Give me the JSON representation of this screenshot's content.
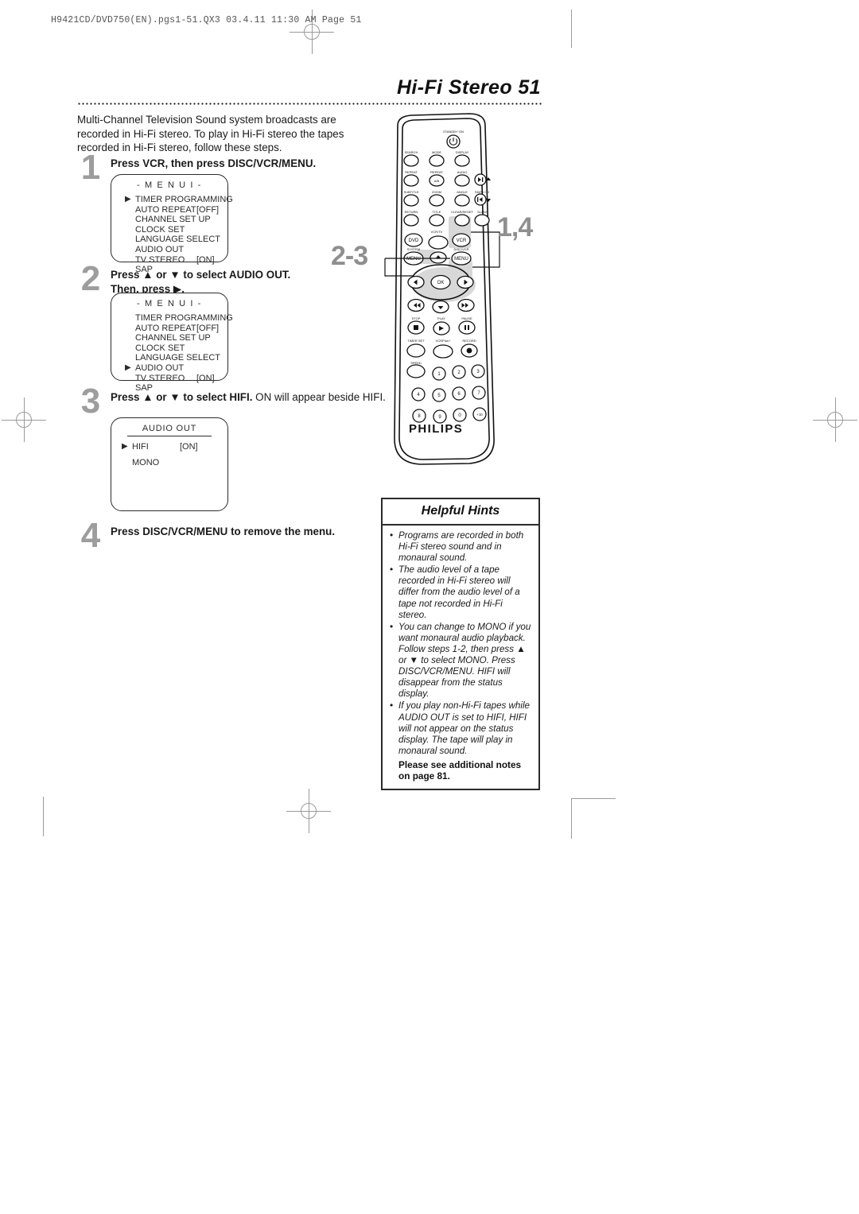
{
  "prepress": {
    "file_header": "H9421CD/DVD750(EN).pgs1-51.QX3  03.4.11 11:30 AM  Page 51"
  },
  "page": {
    "title": "Hi-Fi Stereo  51",
    "intro": "Multi-Channel Television Sound system broadcasts are recorded in Hi-Fi stereo. To play in Hi-Fi stereo the tapes recorded in Hi-Fi stereo, follow these steps."
  },
  "steps": [
    {
      "num": "1",
      "text_html": "Press VCR, then press DISC/VCR/MENU."
    },
    {
      "num": "2",
      "text_html": "Press ▲ or ▼ to select AUDIO OUT. Then, press ▶."
    },
    {
      "num": "3",
      "text_html": "Press ▲ or ▼ to select HIFI. ON will appear beside HIFI."
    },
    {
      "num": "4",
      "text_html": "Press DISC/VCR/MENU to remove the menu."
    }
  ],
  "step_labels": {
    "s1_bold": "Press VCR, then press DISC/VCR/MENU.",
    "s2_bold_a": "Press",
    "s2_bold_b": "or",
    "s2_bold_c": "to select AUDIO OUT.",
    "s2_bold_d": "Then, press",
    "s3_bold_a": "Press",
    "s3_bold_b": "or",
    "s3_bold_c": "to select HIFI.",
    "s3_rest": "ON will appear beside HIFI.",
    "s4_a": "Press",
    "s4_b": "DISC/VCR/MENU",
    "s4_c": "to remove the menu."
  },
  "osd_menu_1": {
    "title": "- M E N U  I -",
    "cursor_index": 0,
    "items": [
      {
        "label": "TIMER PROGRAMMING",
        "value": ""
      },
      {
        "label": "AUTO REPEAT",
        "value": "[OFF]"
      },
      {
        "label": "CHANNEL SET UP",
        "value": ""
      },
      {
        "label": "CLOCK SET",
        "value": ""
      },
      {
        "label": "LANGUAGE SELECT",
        "value": ""
      },
      {
        "label": "AUDIO OUT",
        "value": ""
      },
      {
        "label": "TV STEREO",
        "value": "[ON]"
      },
      {
        "label": "SAP",
        "value": ""
      }
    ]
  },
  "osd_menu_2": {
    "title": "- M E N U  I -",
    "cursor_index": 5,
    "items": [
      {
        "label": "TIMER PROGRAMMING",
        "value": ""
      },
      {
        "label": "AUTO REPEAT",
        "value": "[OFF]"
      },
      {
        "label": "CHANNEL SET UP",
        "value": ""
      },
      {
        "label": "CLOCK SET",
        "value": ""
      },
      {
        "label": "LANGUAGE SELECT",
        "value": ""
      },
      {
        "label": "AUDIO OUT",
        "value": ""
      },
      {
        "label": "TV STEREO",
        "value": "[ON]"
      },
      {
        "label": "SAP",
        "value": ""
      }
    ]
  },
  "osd_audio_out": {
    "title": "AUDIO OUT",
    "cursor_index": 0,
    "items": [
      {
        "label": "HIFI",
        "value": "[ON]"
      },
      {
        "label": "MONO",
        "value": ""
      }
    ]
  },
  "hints": {
    "heading": "Helpful Hints",
    "bullets": [
      "Programs are recorded in both Hi-Fi stereo sound and in monaural sound.",
      "The audio level of a tape recorded in Hi-Fi stereo will differ from the audio level of a tape not recorded in Hi-Fi stereo.",
      "You can change to MONO if you want monaural audio playback. Follow steps 1-2, then press ▲ or ▼ to select MONO. Press DISC/VCR/MENU. HIFI will disappear from the status display.",
      "If you play non-Hi-Fi tapes while AUDIO OUT is set to HIFI, HIFI will not appear on the status display. The tape will play in monaural sound."
    ],
    "note": "Please see additional notes on page 81."
  },
  "remote": {
    "brand": "PHILIPS",
    "callout_left": "2-3",
    "callout_right": "1,4",
    "labels": {
      "standby": "STANDBY·ON",
      "row1": [
        "SEARCH",
        "MODE",
        "DISPLAY"
      ],
      "row2": [
        "REPEAT",
        "REPEAT",
        "AUDIO"
      ],
      "row2_extra": "SKIP / CH",
      "row3": [
        "SUBTITLE",
        "ZOOM",
        "ANGLE"
      ],
      "row4": [
        "RETURN",
        "TITLE",
        "CLEAR/RESET",
        "SLOW"
      ],
      "vcrtv": "VCR/TV",
      "dvd": "DVD",
      "vcr": "VCR",
      "system": "SYSTEM",
      "discvcr": "DISC/VCR",
      "menu_left": "MENU",
      "menu_right": "MENU",
      "ok": "OK",
      "transport": [
        "STOP",
        "PLAY",
        "PAUSE"
      ],
      "timer_set": "TIMER SET",
      "vcrplus": "VCRPlus+",
      "record": "RECORD",
      "speed": "SPEED",
      "keypad": [
        "1",
        "2",
        "3",
        "4",
        "5",
        "6",
        "7",
        "8",
        "9",
        "0",
        "+10"
      ],
      "repeat_ab": "A/B"
    }
  },
  "colors": {
    "step_number": "#9d9d9d",
    "osd_border": "#2b2b2b",
    "callout": "#8f8f8f",
    "text": "#1a1a1a",
    "mark": "#9a9a9a"
  }
}
